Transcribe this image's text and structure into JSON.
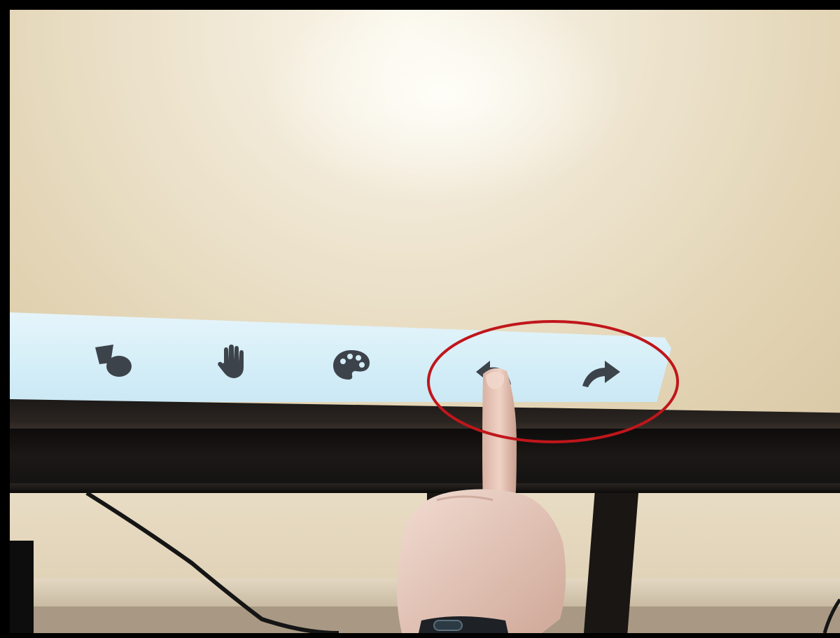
{
  "scene": {
    "description_kind": "photo of an interactive whiteboard toolbar",
    "highlight_color": "#c0161b",
    "toolbar_color": "#d4eef8",
    "icon_color": "#3d434b"
  },
  "toolbar": {
    "tools": [
      {
        "id": "shapes",
        "icon": "shapes-icon"
      },
      {
        "id": "hand",
        "icon": "hand-pan-icon"
      },
      {
        "id": "palette",
        "icon": "palette-icon"
      },
      {
        "id": "undo",
        "icon": "undo-arrow-icon"
      },
      {
        "id": "redo",
        "icon": "redo-arrow-icon"
      }
    ]
  }
}
